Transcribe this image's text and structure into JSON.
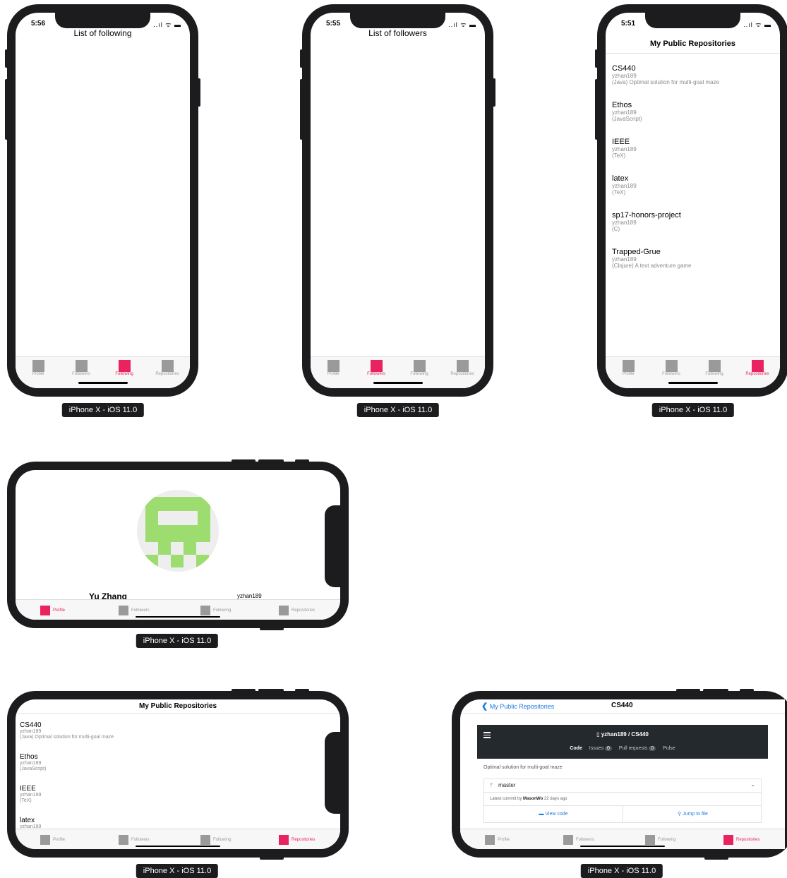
{
  "device_label": "iPhone X - iOS 11.0",
  "tabs": [
    "Profile",
    "Followers",
    "Following",
    "Repositories"
  ],
  "phone1": {
    "time": "5:56",
    "title": "List of following",
    "active_tab": 2
  },
  "phone2": {
    "time": "5:55",
    "title": "List of followers",
    "active_tab": 1
  },
  "phone3": {
    "time": "5:51",
    "title": "My Public Repositories",
    "active_tab": 3
  },
  "status_icons": "..ıl ᯤ ▬",
  "repos": [
    {
      "name": "CS440",
      "owner": "yzhan189",
      "desc": "(Java) Optimal solution for multi-goal maze"
    },
    {
      "name": "Ethos",
      "owner": "yzhan189",
      "desc": "(JavaScript)"
    },
    {
      "name": "IEEE",
      "owner": "yzhan189",
      "desc": "(TeX)"
    },
    {
      "name": "latex",
      "owner": "yzhan189",
      "desc": "(TeX)"
    },
    {
      "name": "sp17-honors-project",
      "owner": "yzhan189",
      "desc": "(C)"
    },
    {
      "name": "Trapped-Grue",
      "owner": "yzhan189",
      "desc": "(Clojure) A text adventure game"
    }
  ],
  "profile": {
    "name": "Yu Zhang",
    "username": "yzhan189",
    "avatar_color": "#9ddc6e"
  },
  "repos_land": {
    "title": "My Public Repositories",
    "partial_owner": "yzhan189"
  },
  "repo_detail": {
    "back_label": "My Public Repositories",
    "title": "CS440",
    "gh_repo": "yzhan189 / CS440",
    "gh_tabs": [
      {
        "label": "Code",
        "count": ""
      },
      {
        "label": "Issues",
        "count": "0"
      },
      {
        "label": "Pull requests",
        "count": "0"
      },
      {
        "label": "Pulse",
        "count": ""
      }
    ],
    "description": "Optimal solution for multi-goal maze",
    "branch": "master",
    "commit_prefix": "Latest commit by",
    "commit_author": "MasonWo",
    "commit_time": "22 days ago",
    "view_code": "View code",
    "jump_to_file": "Jump to file"
  },
  "colors": {
    "accent": "#e8235f",
    "inactive": "#9a9a9a",
    "link": "#1f7ae0",
    "github_dark": "#24292e"
  }
}
